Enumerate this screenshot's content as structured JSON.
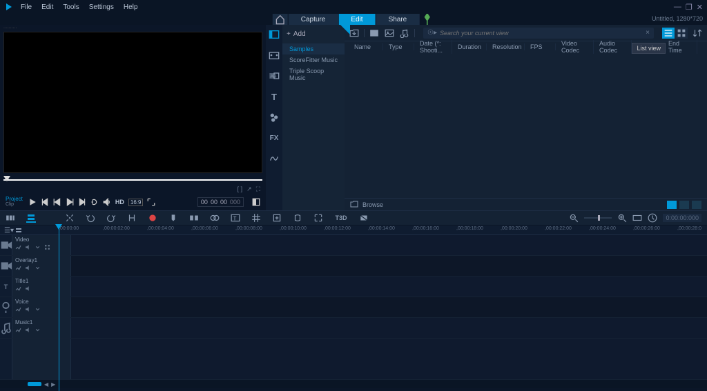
{
  "menu": {
    "file": "File",
    "edit": "Edit",
    "tools": "Tools",
    "settings": "Settings",
    "help": "Help"
  },
  "maintabs": {
    "capture": "Capture",
    "edit": "Edit",
    "share": "Share"
  },
  "status": {
    "project": "Untitled, 1280*720"
  },
  "preview": {
    "dots": "..........",
    "project_label": "Project",
    "clip_label": "Clip",
    "hd": "HD",
    "ratio": "16:9",
    "timecode": {
      "h": "00",
      "m": "00",
      "s": "00",
      "f": "000"
    },
    "markers": "[     ]"
  },
  "library": {
    "add": "Add",
    "folders": [
      "Samples",
      "ScoreFitter Music",
      "Triple Scoop Music"
    ],
    "toolbar_icons": [
      "import",
      "folder",
      "image",
      "music"
    ],
    "search_placeholder": "Search your current view",
    "tooltip": "List view",
    "columns": [
      "Name",
      "Type",
      "Date (*: Shooti...",
      "Duration",
      "Resolution",
      "FPS",
      "Video Codec",
      "Audio Codec",
      "",
      "End Time"
    ],
    "browse": "Browse",
    "side_tabs": [
      "media",
      "marker",
      "subtitle",
      "text",
      "motion",
      "fx",
      "path"
    ]
  },
  "toolbar2": {
    "tools": [
      "storyboard",
      "timeline",
      "settings",
      "undo",
      "redo",
      "mark-in",
      "record",
      "marker2",
      "split",
      "transition",
      "title-tool",
      "grid",
      "pan",
      "loop",
      "expand",
      "t3d",
      "mask"
    ],
    "fx_label": "FX",
    "t3d_label": "T3D",
    "timecode": "0:00:00:000"
  },
  "ruler": {
    "ticks": [
      ",00:00:00",
      ",00:00:02:00",
      ",00:00:04:00",
      ",00:00:06:00",
      ",00:00:08:00",
      ",00:00:10:00",
      ",00:00:12:00",
      ",00:00:14:00",
      ",00:00:16:00",
      ",00:00:18:00",
      ",00:00:20:00",
      ",00:00:22:00",
      ",00:00:24:00",
      ",00:00:26:00",
      ",00:00:28:0"
    ]
  },
  "tracks": [
    {
      "type": "video",
      "label": "Video",
      "icons": 4
    },
    {
      "type": "video",
      "label": "Overlay1",
      "icons": 3
    },
    {
      "type": "title",
      "label": "Title1",
      "icons": 2
    },
    {
      "type": "voice",
      "label": "Voice",
      "icons": 3
    },
    {
      "type": "music",
      "label": "Music1",
      "icons": 3
    }
  ]
}
